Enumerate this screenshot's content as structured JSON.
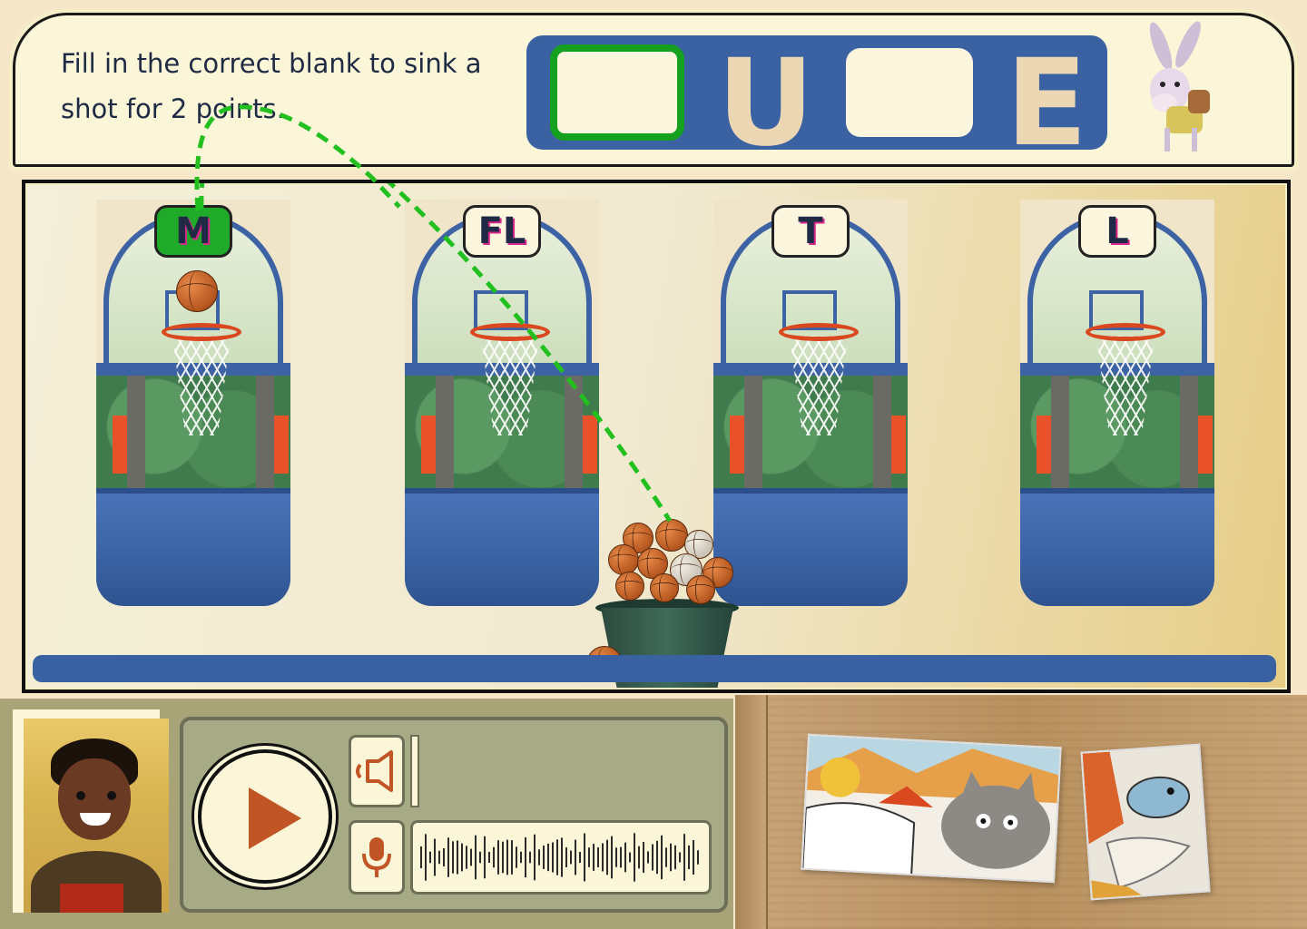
{
  "instruction": {
    "text": "Fill in the correct blank to sink a shot for 2 points."
  },
  "word": {
    "letters": [
      "",
      "U",
      "",
      "E"
    ],
    "active_blank_index": 0
  },
  "choices": [
    {
      "label": "M",
      "selected": true
    },
    {
      "label": "FL",
      "selected": false
    },
    {
      "label": "T",
      "selected": false
    },
    {
      "label": "L",
      "selected": false
    }
  ],
  "colors": {
    "accent_green": "#1faa2a",
    "brand_blue": "#3a62a3",
    "cream": "#fbf6d8",
    "play_orange": "#c25526"
  },
  "audio": {
    "play_icon": "play-icon",
    "speaker_icon": "speaker-icon",
    "mic_icon": "microphone-icon"
  },
  "story_cards": [
    "cat-illustration",
    "fish-illustration"
  ]
}
